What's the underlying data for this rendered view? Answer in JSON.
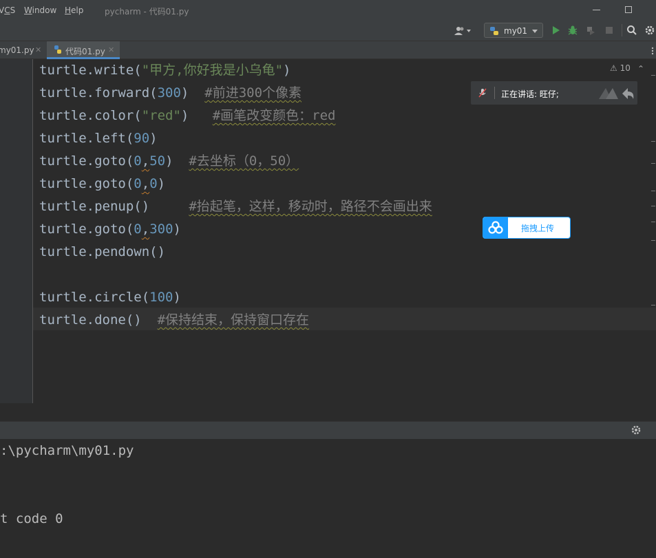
{
  "menu": {
    "items": [
      {
        "label": "VCS",
        "mnemonic": "C"
      },
      {
        "label": "Window",
        "mnemonic": "W"
      },
      {
        "label": "Help",
        "mnemonic": "H"
      }
    ],
    "window_title": "pycharm - 代码01.py"
  },
  "toolbar": {
    "run_config": "my01",
    "icons": [
      "user-icon",
      "run-icon",
      "debug-icon",
      "coverage-icon",
      "stop-icon",
      "search-icon",
      "settings-icon"
    ]
  },
  "tabs": [
    {
      "label": "my01.py",
      "close": "✕",
      "active": false
    },
    {
      "label": "代码01.py",
      "close": "✕",
      "active": true
    }
  ],
  "editor": {
    "inspection_count": "10",
    "warning_icon": "⚠",
    "lines": [
      {
        "parts": [
          {
            "t": "turtle.write(",
            "c": ""
          },
          {
            "t": "\"甲方,你好我是小乌龟\"",
            "c": "str"
          },
          {
            "t": ")",
            "c": ""
          }
        ]
      },
      {
        "parts": [
          {
            "t": "turtle.forward(",
            "c": ""
          },
          {
            "t": "300",
            "c": "num"
          },
          {
            "t": ")  ",
            "c": ""
          },
          {
            "t": "#前进300个像素",
            "c": "cmt"
          }
        ]
      },
      {
        "parts": [
          {
            "t": "turtle.color(",
            "c": ""
          },
          {
            "t": "\"red\"",
            "c": "str"
          },
          {
            "t": ")   ",
            "c": ""
          },
          {
            "t": "#画笔改变颜色：red",
            "c": "cmt"
          }
        ]
      },
      {
        "parts": [
          {
            "t": "turtle.left(",
            "c": ""
          },
          {
            "t": "90",
            "c": "num"
          },
          {
            "t": ")",
            "c": ""
          }
        ]
      },
      {
        "parts": [
          {
            "t": "turtle.goto(",
            "c": ""
          },
          {
            "t": "0",
            "c": "num"
          },
          {
            "t": ",",
            "c": "comma-warn"
          },
          {
            "t": "50",
            "c": "num"
          },
          {
            "t": ")  ",
            "c": ""
          },
          {
            "t": "#去坐标（0，50）",
            "c": "cmt"
          }
        ]
      },
      {
        "parts": [
          {
            "t": "turtle.goto(",
            "c": ""
          },
          {
            "t": "0",
            "c": "num"
          },
          {
            "t": ",",
            "c": "comma-warn"
          },
          {
            "t": "0",
            "c": "num"
          },
          {
            "t": ")",
            "c": ""
          }
        ]
      },
      {
        "parts": [
          {
            "t": "turtle.penup()     ",
            "c": ""
          },
          {
            "t": "#抬起笔，这样，移动时，路径不会画出来",
            "c": "cmt"
          }
        ]
      },
      {
        "parts": [
          {
            "t": "turtle.goto(",
            "c": ""
          },
          {
            "t": "0",
            "c": "num"
          },
          {
            "t": ",",
            "c": "comma-warn"
          },
          {
            "t": "300",
            "c": "num"
          },
          {
            "t": ")",
            "c": ""
          }
        ]
      },
      {
        "parts": [
          {
            "t": "turtle.pendown()",
            "c": ""
          }
        ]
      },
      {
        "parts": []
      },
      {
        "parts": [
          {
            "t": "turtle.circle(",
            "c": ""
          },
          {
            "t": "100",
            "c": "num"
          },
          {
            "t": ")",
            "c": ""
          }
        ]
      },
      {
        "parts": [
          {
            "t": "turtle.done()  ",
            "c": ""
          },
          {
            "t": "#保持结束，保持窗口存在",
            "c": "cmt"
          }
        ]
      }
    ]
  },
  "overlays": {
    "talk_text": "正在讲话: 旺仔;",
    "upload_label": "拖拽上传"
  },
  "run_output": {
    "lines": [
      ":\\pycharm\\my01.py",
      "",
      "",
      "t code 0"
    ]
  },
  "colors": {
    "background": "#2b2b2b",
    "chrome": "#3c3f41",
    "string": "#6a8759",
    "number": "#6897bb",
    "comment": "#808080",
    "accent": "#4a88c7",
    "upload_blue": "#1a9bff"
  }
}
